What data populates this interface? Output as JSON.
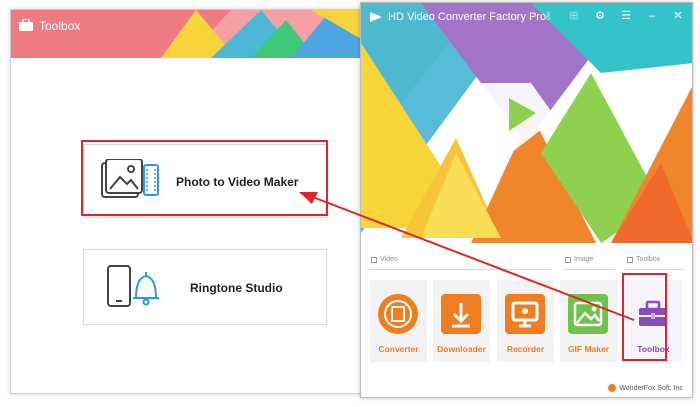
{
  "toolbox_window": {
    "title": "Toolbox",
    "tools": [
      {
        "label": "Photo to Video Maker",
        "icon": "photo-film-icon"
      },
      {
        "label": "Ringtone Studio",
        "icon": "phone-bell-icon"
      }
    ]
  },
  "main_window": {
    "title": "HD Video Converter Factory Pro",
    "title_icons": [
      "key-icon",
      "cart-icon",
      "settings-icon",
      "menu-icon",
      "minimize-icon",
      "close-icon"
    ],
    "sections": [
      "Video",
      "Image",
      "Toolbox"
    ],
    "apps": [
      {
        "label": "Converter",
        "icon": "film-reel-icon"
      },
      {
        "label": "Downloader",
        "icon": "download-icon"
      },
      {
        "label": "Recorder",
        "icon": "monitor-icon"
      },
      {
        "label": "GIF Maker",
        "icon": "image-icon"
      },
      {
        "label": "Toolbox",
        "icon": "toolbox-icon"
      }
    ],
    "footer": "WonderFox Soft, Inc"
  },
  "colors": {
    "highlight": "#e1242a",
    "accent_orange": "#f07d1f",
    "accent_purple": "#8a4db8"
  }
}
